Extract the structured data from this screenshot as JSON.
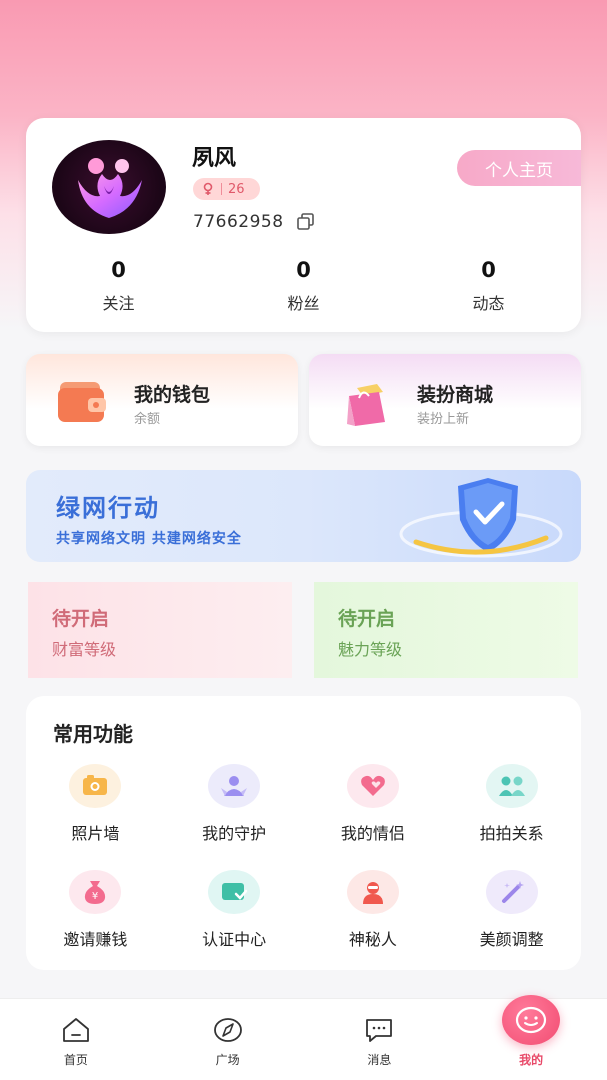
{
  "profile": {
    "username": "夙风",
    "level": "26",
    "uid": "77662958",
    "homepage_label": "个人主页",
    "stats": [
      {
        "value": "0",
        "label": "关注"
      },
      {
        "value": "0",
        "label": "粉丝"
      },
      {
        "value": "0",
        "label": "动态"
      }
    ]
  },
  "wallet": {
    "title": "我的钱包",
    "subtitle": "余额"
  },
  "mall": {
    "title": "装扮商城",
    "subtitle": "装扮上新"
  },
  "banner": {
    "title": "绿网行动",
    "subtitle": "共享网络文明 共建网络安全"
  },
  "levels": {
    "wealth": {
      "status": "待开启",
      "label": "财富等级"
    },
    "charm": {
      "status": "待开启",
      "label": "魅力等级"
    }
  },
  "functions": {
    "title": "常用功能",
    "items": [
      {
        "label": "照片墙",
        "icon": "photo-wall-icon"
      },
      {
        "label": "我的守护",
        "icon": "guardian-icon"
      },
      {
        "label": "我的情侣",
        "icon": "couple-heart-icon"
      },
      {
        "label": "拍拍关系",
        "icon": "relationship-icon"
      },
      {
        "label": "邀请赚钱",
        "icon": "money-bag-icon"
      },
      {
        "label": "认证中心",
        "icon": "certification-icon"
      },
      {
        "label": "神秘人",
        "icon": "mystery-person-icon"
      },
      {
        "label": "美颜调整",
        "icon": "beauty-wand-icon"
      }
    ]
  },
  "nav": {
    "items": [
      {
        "label": "首页",
        "icon": "home-icon"
      },
      {
        "label": "广场",
        "icon": "compass-icon"
      },
      {
        "label": "消息",
        "icon": "message-icon"
      },
      {
        "label": "我的",
        "icon": "smile-face-icon"
      }
    ]
  },
  "colors": {
    "accent": "#f24d72",
    "banner_text": "#3a6fd8",
    "wealth_text": "#d06b78",
    "charm_text": "#6aa356"
  }
}
